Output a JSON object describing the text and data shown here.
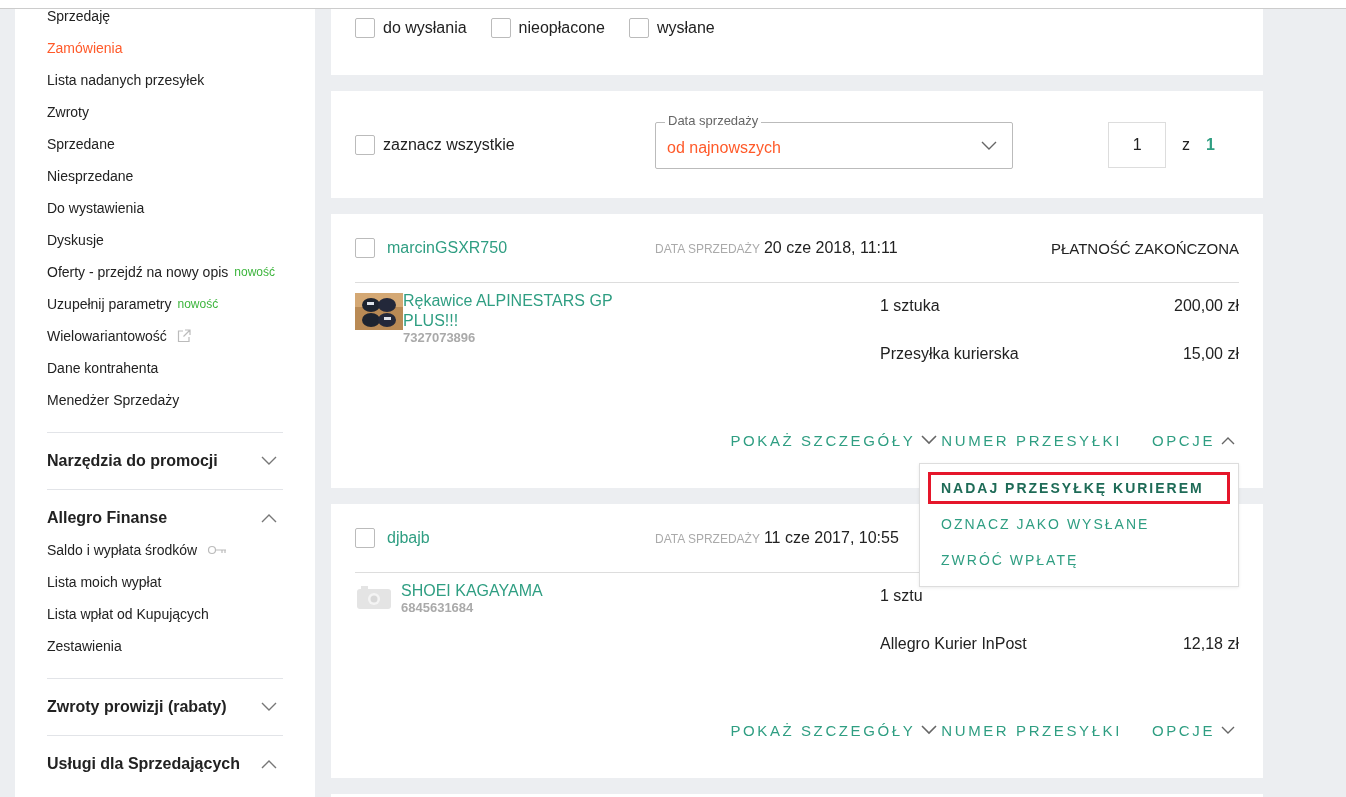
{
  "sidebar": {
    "items": [
      {
        "label": "Sprzedaję",
        "selected": false
      },
      {
        "label": "Zamówienia",
        "selected": true
      },
      {
        "label": "Lista nadanych przesyłek",
        "selected": false
      },
      {
        "label": "Zwroty",
        "selected": false
      },
      {
        "label": "Sprzedane",
        "selected": false
      },
      {
        "label": "Niesprzedane",
        "selected": false
      },
      {
        "label": "Do wystawienia",
        "selected": false
      },
      {
        "label": "Dyskusje",
        "selected": false
      },
      {
        "label": "Oferty - przejdź na nowy opis",
        "selected": false,
        "badge": "nowość"
      },
      {
        "label": "Uzupełnij parametry",
        "selected": false,
        "badge": "nowość"
      },
      {
        "label": "Wielowariantowość",
        "selected": false,
        "external": true
      },
      {
        "label": "Dane kontrahenta",
        "selected": false
      },
      {
        "label": "Menedżer Sprzedaży",
        "selected": false
      }
    ],
    "sections": [
      {
        "title": "Narzędzia do promocji",
        "expanded": false
      },
      {
        "title": "Allegro Finanse",
        "expanded": true,
        "items": [
          {
            "label": "Saldo i wypłata środków",
            "selected": false,
            "secured": true
          },
          {
            "label": "Lista moich wypłat",
            "selected": false
          },
          {
            "label": "Lista wpłat od Kupujących",
            "selected": false
          },
          {
            "label": "Zestawienia",
            "selected": false
          }
        ]
      },
      {
        "title": "Zwroty prowizji (rabaty)",
        "expanded": false
      },
      {
        "title": "Usługi dla Sprzedających",
        "expanded": true
      }
    ]
  },
  "filters": [
    {
      "label": "do wysłania",
      "checked": false
    },
    {
      "label": "nieopłacone",
      "checked": false
    },
    {
      "label": "wysłane",
      "checked": false
    }
  ],
  "toolbar": {
    "select_all": {
      "label": "zaznacz wszystkie",
      "checked": false
    },
    "sort": {
      "label": "Data sprzedaży",
      "value": "od najnowszych"
    },
    "pagination": {
      "page": "1",
      "separator": "z",
      "total": "1"
    }
  },
  "orders": [
    {
      "buyer": "marcinGSXR750",
      "checked": false,
      "date_label": "DATA SPRZEDAŻY",
      "date": "20 cze 2018, 11:11",
      "status": "PŁATNOŚĆ ZAKOŃCZONA",
      "item": {
        "title": "Rękawice ALPINESTARS GP PLUS!!!",
        "id": "7327073896",
        "photo": true,
        "quantity": "1 sztuka",
        "price": "200,00 zł"
      },
      "shipping": {
        "method": "Przesyłka kurierska",
        "price": "15,00 zł"
      },
      "actions": {
        "details": "POKAŻ SZCZEGÓŁY",
        "tracking": "NUMER PRZESYŁKI",
        "options": "OPCJE",
        "expanded": true
      },
      "menu": [
        {
          "label": "NADAJ PRZESYŁKĘ KURIEREM",
          "highlighted": true
        },
        {
          "label": "OZNACZ JAKO WYSŁANE",
          "highlighted": false
        },
        {
          "label": "ZWRÓĆ WPŁATĘ",
          "highlighted": false
        }
      ]
    },
    {
      "buyer": "djbajb",
      "checked": false,
      "date_label": "DATA SPRZEDAŻY",
      "date": "11 cze 2017, 10:55",
      "item": {
        "title": "SHOEI KAGAYAMA",
        "id": "6845631684",
        "photo": false,
        "quantity": "1 sztu"
      },
      "shipping": {
        "method": "Allegro Kurier InPost",
        "price": "12,18 zł"
      },
      "actions": {
        "details": "POKAŻ SZCZEGÓŁY",
        "tracking": "NUMER PRZESYŁKI",
        "options": "OPCJE",
        "expanded": false
      }
    }
  ]
}
